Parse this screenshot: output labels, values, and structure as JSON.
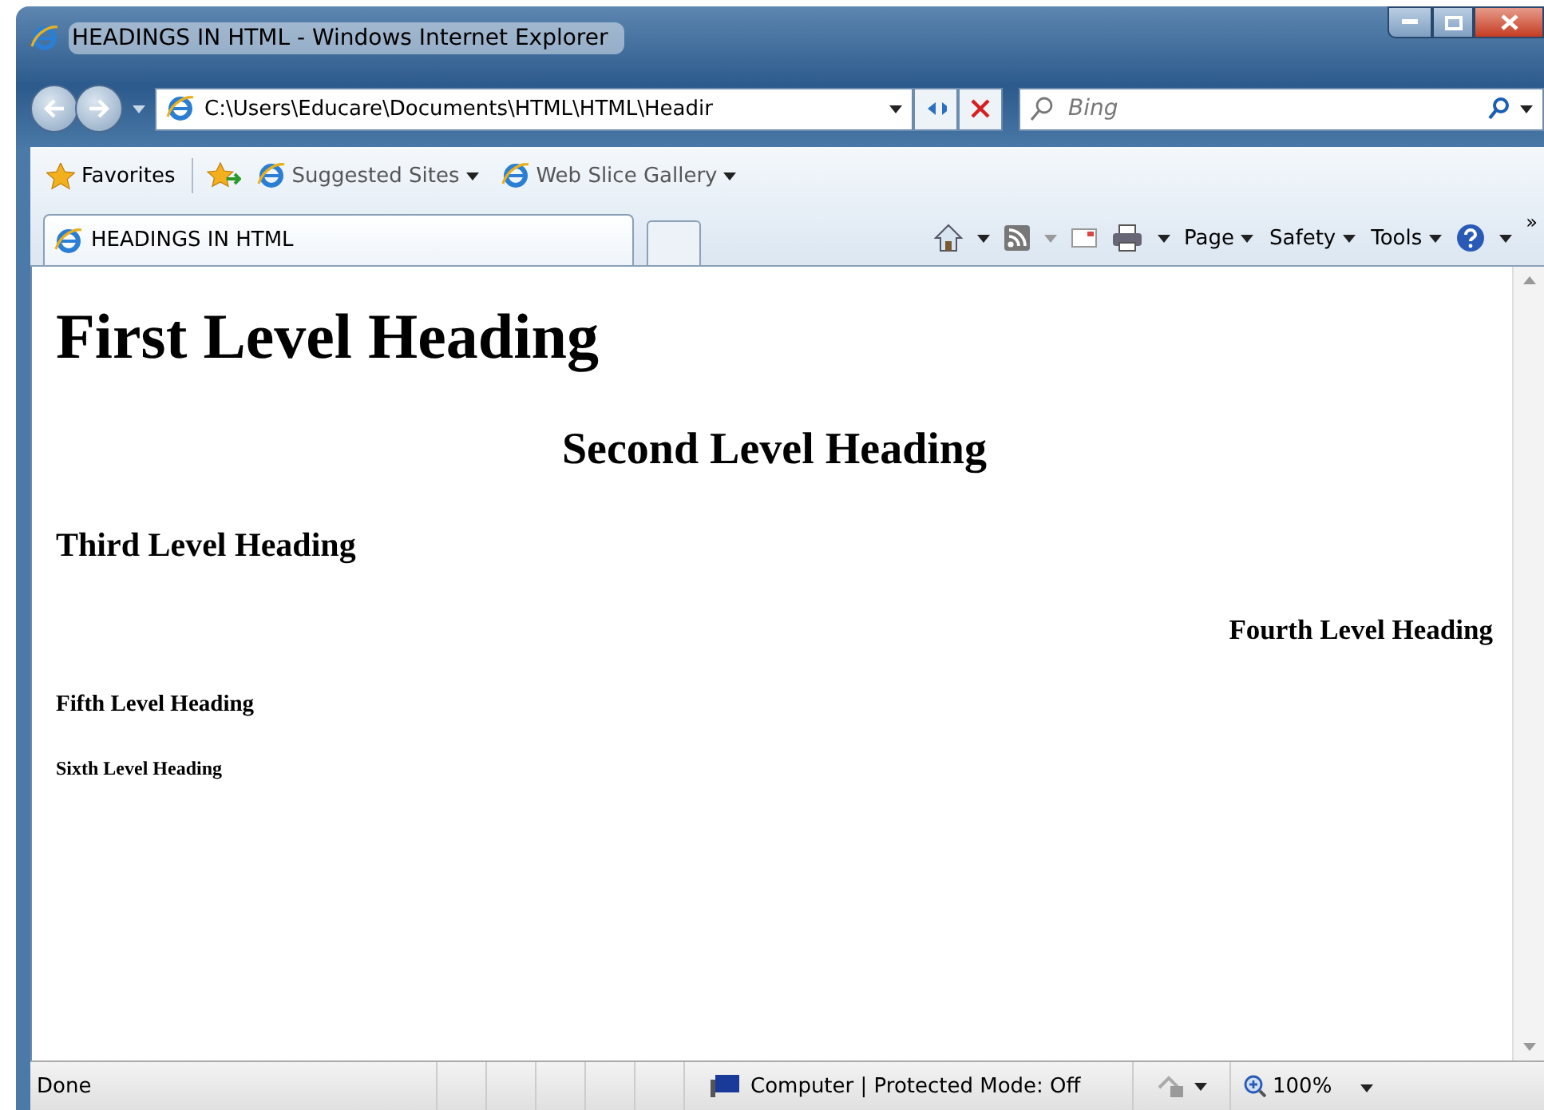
{
  "window": {
    "title": "HEADINGS IN HTML - Windows Internet Explorer"
  },
  "address_bar": {
    "value": "C:\\Users\\Educare\\Documents\\HTML\\HTML\\Headir"
  },
  "search": {
    "placeholder": "Bing"
  },
  "favorites_bar": {
    "favorites": "Favorites",
    "items": [
      {
        "label": "Suggested Sites"
      },
      {
        "label": "Web Slice Gallery"
      }
    ]
  },
  "tabs": [
    {
      "label": "HEADINGS IN HTML",
      "selected": true
    }
  ],
  "command_bar": {
    "menus": [
      "Page",
      "Safety",
      "Tools"
    ],
    "overflow": "»"
  },
  "page": {
    "headings": [
      {
        "text": "First Level Heading",
        "kind": "h1"
      },
      {
        "text": "Second Level Heading",
        "kind": "h2-center"
      },
      {
        "text": "Third Level Heading",
        "kind": "h3"
      },
      {
        "text": "Fourth Level Heading",
        "kind": "h4-right"
      },
      {
        "text": "Fifth Level Heading",
        "kind": "h5"
      },
      {
        "text": "Sixth Level Heading",
        "kind": "h6"
      }
    ]
  },
  "status_bar": {
    "status": "Done",
    "zone": "Computer | Protected Mode: Off",
    "zoom": "100%"
  }
}
